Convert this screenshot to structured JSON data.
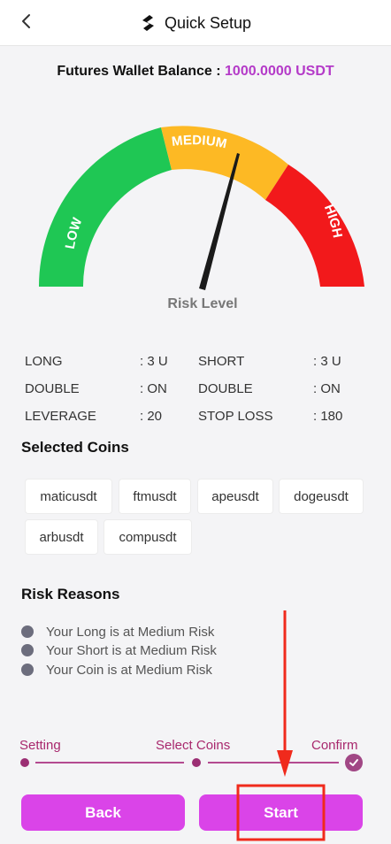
{
  "header": {
    "title": "Quick Setup",
    "back_icon": "chevron-left-icon",
    "logo_icon": "brand-logo-icon"
  },
  "balance": {
    "label": "Futures Wallet Balance :",
    "value": "1000.0000 USDT"
  },
  "gauge": {
    "low_label": "LOW",
    "medium_label": "MEDIUM",
    "high_label": "HIGH",
    "caption": "Risk Level",
    "level": "medium",
    "colors": {
      "low": "#1fc754",
      "medium": "#fdb924",
      "high": "#f2191b"
    }
  },
  "stats": {
    "left": [
      {
        "label": "LONG",
        "value": ": 3 U"
      },
      {
        "label": "DOUBLE",
        "value": ": ON"
      },
      {
        "label": "LEVERAGE",
        "value": ": 20"
      }
    ],
    "right": [
      {
        "label": "SHORT",
        "value": ": 3 U"
      },
      {
        "label": "DOUBLE",
        "value": ": ON"
      },
      {
        "label": "STOP LOSS",
        "value": ": 180"
      }
    ]
  },
  "coins": {
    "title": "Selected Coins",
    "items": [
      "maticusdt",
      "ftmusdt",
      "apeusdt",
      "dogeusdt",
      "arbusdt",
      "compusdt"
    ]
  },
  "risk_reasons": {
    "title": "Risk Reasons",
    "items": [
      "Your Long is at Medium Risk",
      "Your Short is at Medium Risk",
      "Your Coin is at Medium Risk"
    ]
  },
  "steps": {
    "items": [
      "Setting",
      "Select Coins",
      "Confirm"
    ],
    "current": "Confirm"
  },
  "buttons": {
    "back": "Back",
    "start": "Start"
  },
  "colors": {
    "accent": "#da44e8",
    "balance_value": "#b43ac8",
    "step": "#a8286d",
    "annotation": "#f02a1c"
  }
}
